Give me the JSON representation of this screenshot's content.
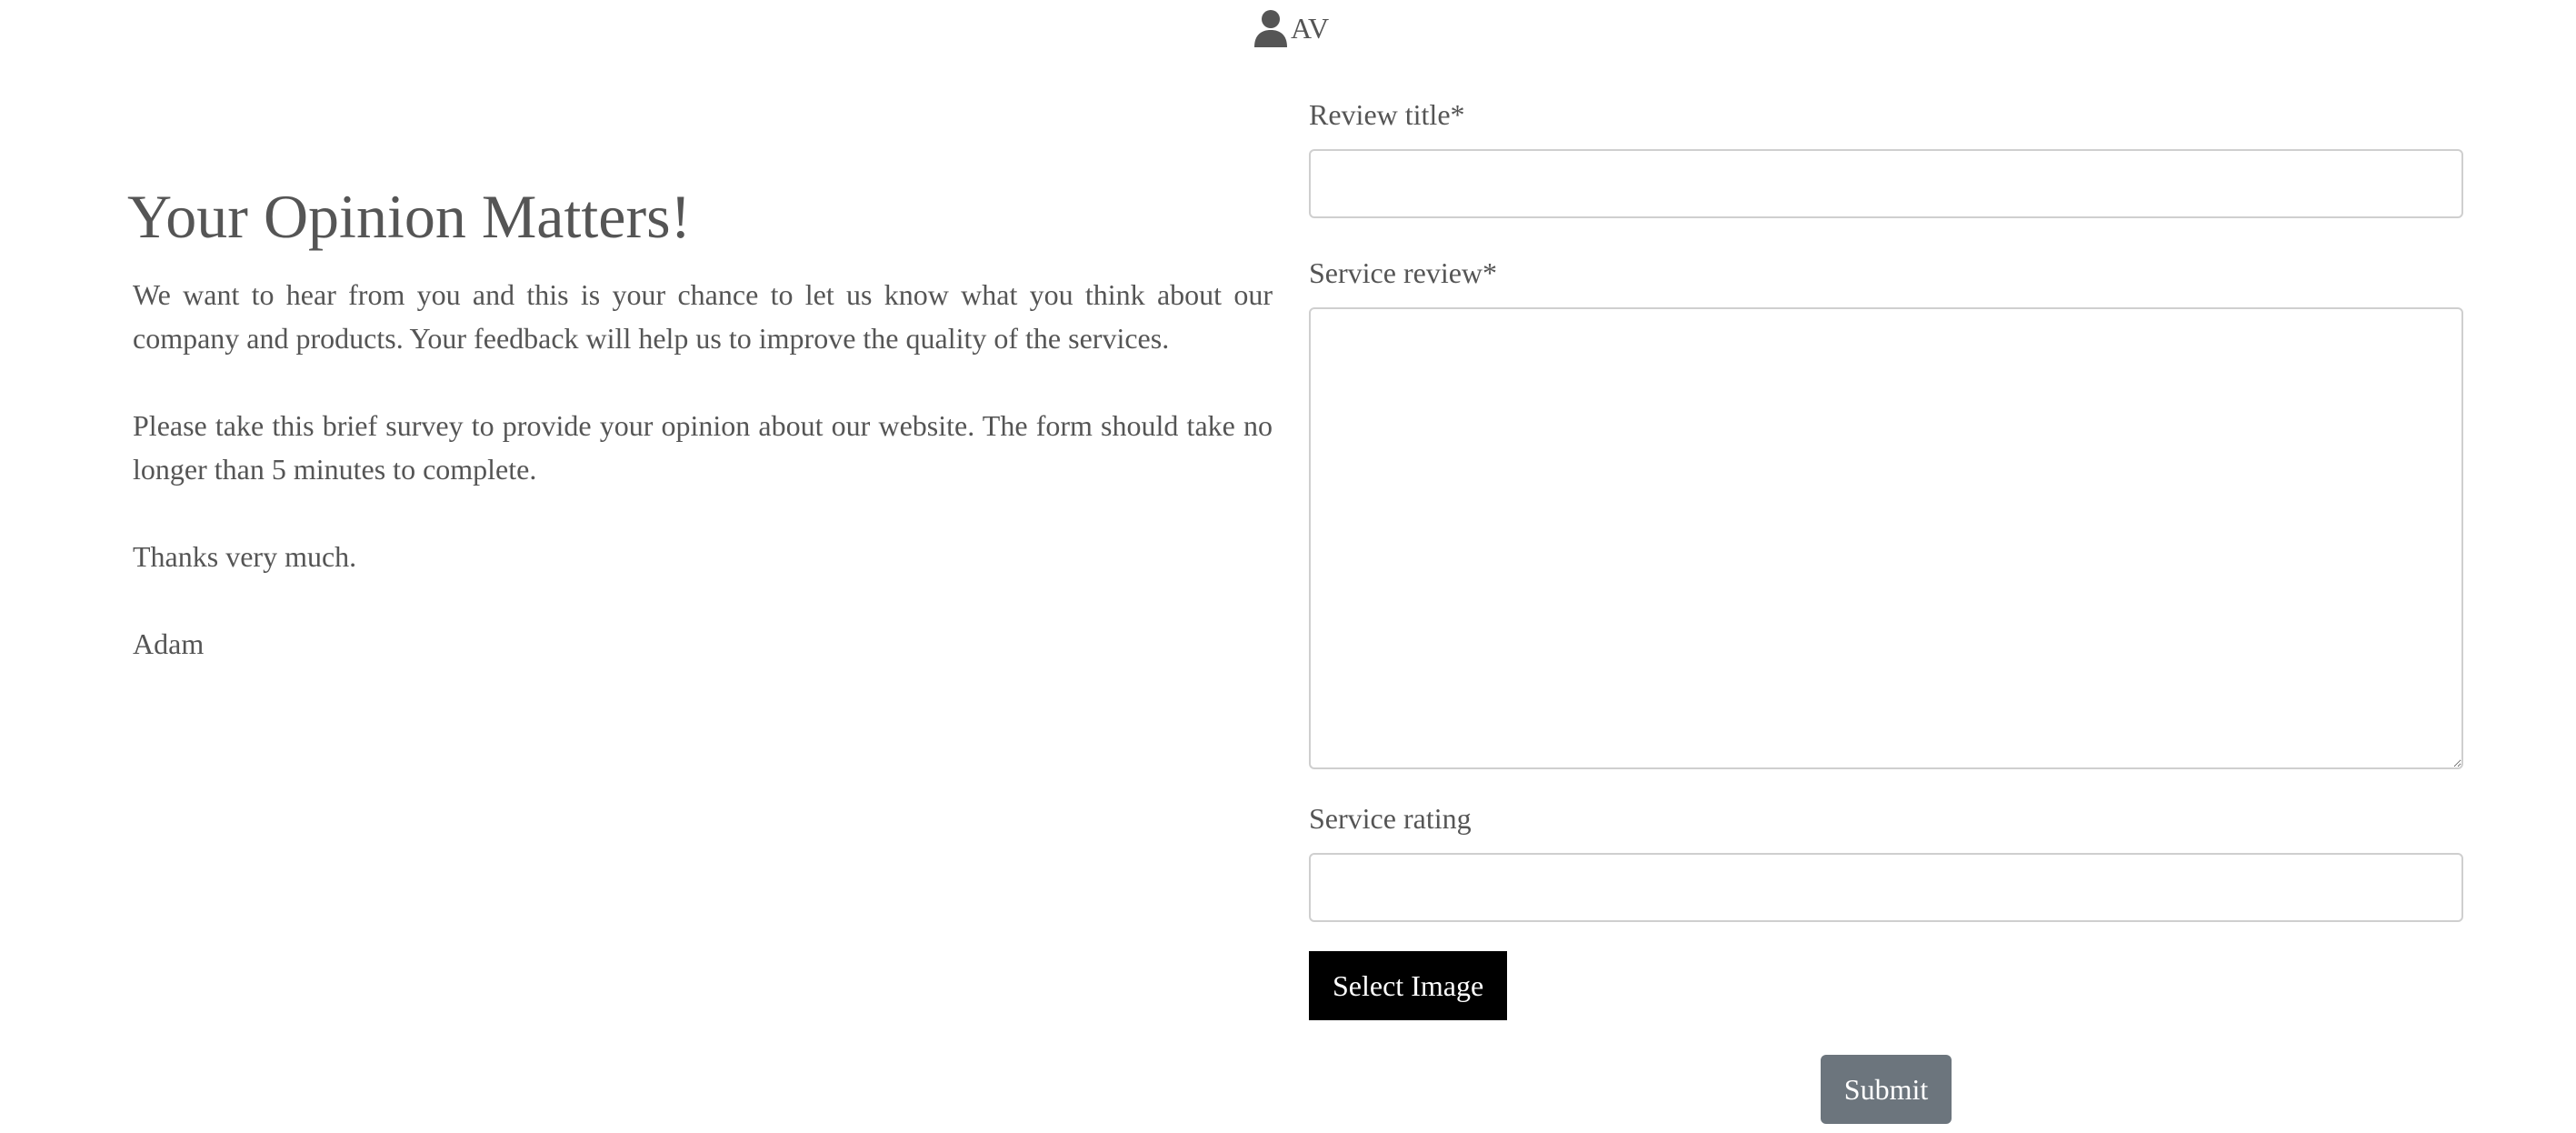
{
  "user": {
    "initials": "AV",
    "icon": "user-icon"
  },
  "intro": {
    "title": "Your Opinion Matters!",
    "paragraphs": [
      "We want to hear from you and this is your chance to let us know what you think about our company and products. Your feedback will help us to improve the quality of the services.",
      "Please take this brief survey to provide your opinion about our website. The form should take no longer than 5 minutes to complete.",
      "Thanks very much.",
      "Adam"
    ]
  },
  "form": {
    "review_title_label": "Review title*",
    "review_title_value": "",
    "service_review_label": "Service review*",
    "service_review_value": "",
    "service_rating_label": "Service rating",
    "service_rating_value": "",
    "select_image_label": "Select Image",
    "submit_label": "Submit"
  },
  "colors": {
    "text": "#555555",
    "select_image_bg": "#000000",
    "submit_bg": "#6c757d",
    "input_border": "#cfcfcf"
  }
}
